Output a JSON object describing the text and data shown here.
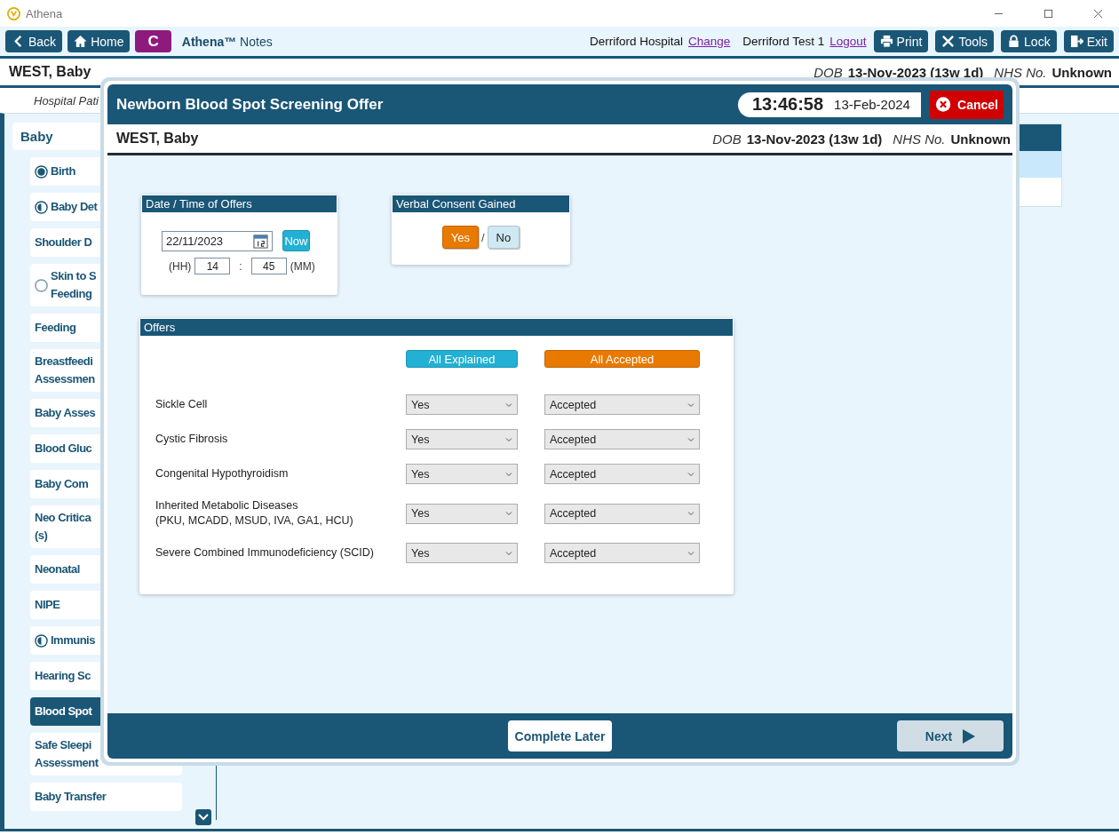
{
  "window": {
    "title": "Athena"
  },
  "toolbar": {
    "back": "Back",
    "home": "Home",
    "badge": "C",
    "app_name": "**Athena™** Notes",
    "location": "Derriford Hospital",
    "location_link": "Change",
    "user": "Derriford Test 1",
    "user_link": "Logout",
    "buttons": [
      {
        "label": "Print",
        "kind": "print"
      },
      {
        "label": "Tools",
        "kind": "tools"
      },
      {
        "label": "Lock",
        "kind": "lock"
      },
      {
        "label": "Exit",
        "kind": "exit"
      }
    ]
  },
  "patient": {
    "name": "WEST, Baby",
    "dob_label": "DOB",
    "dob": "13-Nov-2023 (13w 1d)",
    "nhs_label": "NHS No.",
    "nhs": "Unknown"
  },
  "subbar": {
    "text": "Hospital Pati"
  },
  "sidebar": {
    "section": "Baby",
    "items": [
      {
        "label": "Birth",
        "kind": "full",
        "selected": false
      },
      {
        "label": "Baby Det",
        "kind": "half",
        "selected": false
      },
      {
        "label": "Shoulder D",
        "kind": "plain",
        "selected": false
      },
      {
        "label": "Skin to S\nFeeding",
        "kind": "empty",
        "selected": false
      },
      {
        "label": "Feeding",
        "kind": "plain",
        "selected": false
      },
      {
        "label": "Breastfeedi\nAssessmen",
        "kind": "plain",
        "selected": false
      },
      {
        "label": "Baby Asses",
        "kind": "plain",
        "selected": false
      },
      {
        "label": "Blood Gluc",
        "kind": "plain",
        "selected": false
      },
      {
        "label": "Baby Com",
        "kind": "plain",
        "selected": false
      },
      {
        "label": "Neo Critica\n(s)",
        "kind": "plain",
        "selected": false
      },
      {
        "label": "Neonatal",
        "kind": "plain",
        "selected": false
      },
      {
        "label": "NIPE",
        "kind": "plain",
        "selected": false
      },
      {
        "label": "Immunis",
        "kind": "half",
        "selected": false
      },
      {
        "label": "Hearing Sc",
        "kind": "plain",
        "selected": false
      },
      {
        "label": "Blood Spot",
        "kind": "plain",
        "selected": true
      },
      {
        "label": "Safe Sleepi\nAssessment",
        "kind": "plain",
        "selected": false
      },
      {
        "label": "Baby Transfer",
        "kind": "plain",
        "selected": false
      }
    ]
  },
  "dialog": {
    "title": "Newborn Blood Spot Screening Offer",
    "clock": {
      "time": "13:46:58",
      "date": "13-Feb-2024"
    },
    "cancel": "Cancel",
    "patient": {
      "name": "WEST, Baby",
      "dob_label": "DOB",
      "dob": "13-Nov-2023 (13w 1d)",
      "nhs_label": "NHS No.",
      "nhs": "Unknown"
    },
    "date_card": {
      "title": "Date / Time of Offers",
      "date": "22/11/2023",
      "now": "Now",
      "hh_label": "(HH)",
      "hours": "14",
      "separator": ":",
      "minutes": "45",
      "mm_label": "(MM)"
    },
    "consent_card": {
      "title": "Verbal Consent Gained",
      "separator": "/",
      "options": [
        {
          "label": "Yes",
          "selected": true
        },
        {
          "label": "No",
          "selected": false
        }
      ]
    },
    "offers": {
      "title": "Offers",
      "all_explained": "All Explained",
      "all_accepted": "All Accepted",
      "rows": [
        {
          "label": "Sickle Cell",
          "explained": "Yes",
          "accepted": "Accepted"
        },
        {
          "label": "Cystic Fibrosis",
          "explained": "Yes",
          "accepted": "Accepted"
        },
        {
          "label": "Congenital Hypothyroidism",
          "explained": "Yes",
          "accepted": "Accepted"
        },
        {
          "label": "Inherited Metabolic Diseases\n(PKU, MCADD, MSUD, IVA, GA1, HCU)",
          "explained": "Yes",
          "accepted": "Accepted"
        },
        {
          "label": "Severe Combined Immunodeficiency (SCID)",
          "explained": "Yes",
          "accepted": "Accepted"
        }
      ]
    },
    "footer": {
      "complete_later": "Complete Later",
      "next": "Next"
    }
  }
}
